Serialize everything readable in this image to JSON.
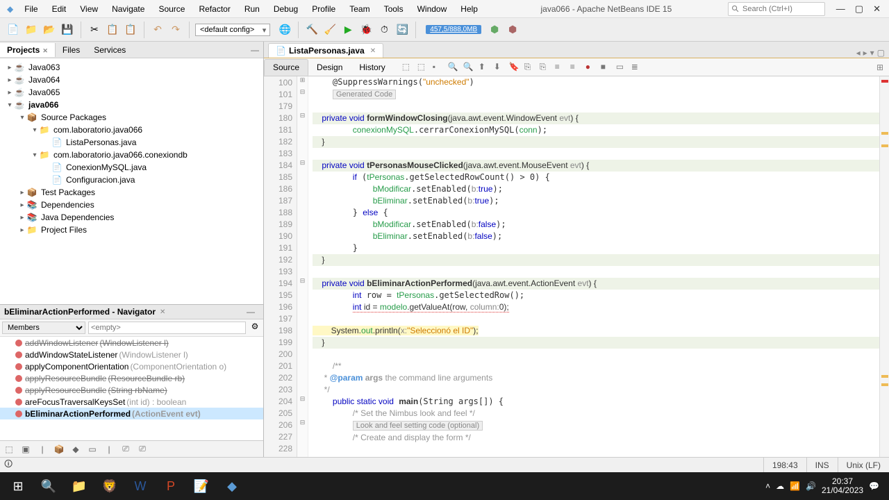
{
  "window": {
    "title": "java066 - Apache NetBeans IDE 15",
    "search_placeholder": "Search (Ctrl+I)"
  },
  "menu": [
    "File",
    "Edit",
    "View",
    "Navigate",
    "Source",
    "Refactor",
    "Run",
    "Debug",
    "Profile",
    "Team",
    "Tools",
    "Window",
    "Help"
  ],
  "toolbar": {
    "config": "<default config>",
    "memory": "457,5/888,0MB"
  },
  "projects": {
    "tabs": [
      "Projects",
      "Files",
      "Services"
    ],
    "tree": [
      {
        "d": 0,
        "exp": "▸",
        "icon": "☕",
        "label": "Java063"
      },
      {
        "d": 0,
        "exp": "▸",
        "icon": "☕",
        "label": "Java064"
      },
      {
        "d": 0,
        "exp": "▸",
        "icon": "☕",
        "label": "Java065"
      },
      {
        "d": 0,
        "exp": "▾",
        "icon": "☕",
        "label": "java066",
        "bold": true
      },
      {
        "d": 1,
        "exp": "▾",
        "icon": "📦",
        "label": "Source Packages"
      },
      {
        "d": 2,
        "exp": "▾",
        "icon": "📁",
        "label": "com.laboratorio.java066"
      },
      {
        "d": 3,
        "exp": "",
        "icon": "📄",
        "label": "ListaPersonas.java"
      },
      {
        "d": 2,
        "exp": "▾",
        "icon": "📁",
        "label": "com.laboratorio.java066.conexiondb"
      },
      {
        "d": 3,
        "exp": "",
        "icon": "📄",
        "label": "ConexionMySQL.java"
      },
      {
        "d": 3,
        "exp": "",
        "icon": "📄",
        "label": "Configuracion.java"
      },
      {
        "d": 1,
        "exp": "▸",
        "icon": "📦",
        "label": "Test Packages"
      },
      {
        "d": 1,
        "exp": "▸",
        "icon": "📚",
        "label": "Dependencies"
      },
      {
        "d": 1,
        "exp": "▸",
        "icon": "📚",
        "label": "Java Dependencies"
      },
      {
        "d": 1,
        "exp": "▸",
        "icon": "📁",
        "label": "Project Files"
      }
    ]
  },
  "navigator": {
    "title": "bEliminarActionPerformed - Navigator",
    "filter_mode": "Members",
    "filter_text": "<empty>",
    "items": [
      {
        "name": "addWindowListener",
        "sig": "(WindowListener l)",
        "strike": true
      },
      {
        "name": "addWindowStateListener",
        "sig": "(WindowListener l)",
        "strike": false
      },
      {
        "name": "applyComponentOrientation",
        "sig": "(ComponentOrientation o)",
        "strike": false
      },
      {
        "name": "applyResourceBundle",
        "sig": "(ResourceBundle rb)",
        "strike": true
      },
      {
        "name": "applyResourceBundle",
        "sig": "(String rbName)",
        "strike": true
      },
      {
        "name": "areFocusTraversalKeysSet",
        "sig": "(int id) : boolean",
        "strike": false
      },
      {
        "name": "bEliminarActionPerformed",
        "sig": "(ActionEvent evt)",
        "strike": false,
        "sel": true
      }
    ]
  },
  "editor": {
    "tab_label": "ListaPersonas.java",
    "subtabs": [
      "Source",
      "Design",
      "History"
    ],
    "lines": [
      100,
      101,
      179,
      180,
      181,
      182,
      183,
      184,
      185,
      186,
      187,
      188,
      189,
      190,
      191,
      192,
      193,
      194,
      195,
      196,
      197,
      198,
      199,
      200,
      201,
      202,
      203,
      204,
      205,
      206,
      227,
      228
    ],
    "folded1": "Generated Code",
    "folded2": "Look and feel setting code (optional)"
  },
  "status": {
    "pos": "198:43",
    "ins": "INS",
    "eol": "Unix (LF)"
  },
  "taskbar": {
    "time": "20:37",
    "date": "21/04/2023"
  }
}
